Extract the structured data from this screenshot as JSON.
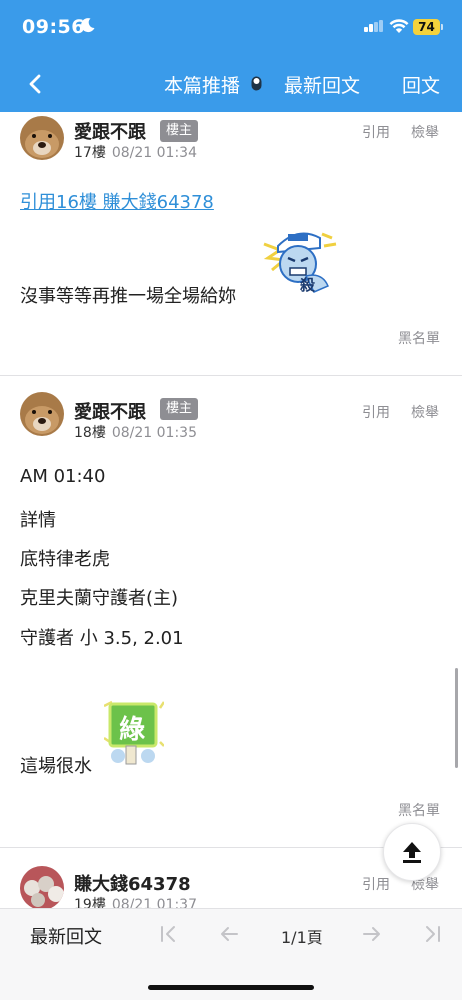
{
  "status_bar": {
    "time": "09:56",
    "battery": "74",
    "moon_icon": "moon-icon",
    "signal_icon": "cellular-signal-icon",
    "wifi_icon": "wifi-icon"
  },
  "nav": {
    "back_icon": "chevron-left-icon",
    "push_label": "本篇推播",
    "latest_label": "最新回文",
    "reply_label": "回文"
  },
  "posts": [
    {
      "username": "愛跟不跟",
      "badge": "樓主",
      "floor": "17樓",
      "timestamp": "08/21 01:34",
      "quote_label": "引用",
      "report_label": "檢舉",
      "quote_link": "引用16樓 賺大錢64378",
      "lines": [
        "沒事等等再推一場全場給妳"
      ],
      "sticker": "angry-kill-sticker",
      "blacklist_label": "黑名單"
    },
    {
      "username": "愛跟不跟",
      "badge": "樓主",
      "floor": "18樓",
      "timestamp": "08/21 01:35",
      "quote_label": "引用",
      "report_label": "檢舉",
      "lines": [
        "AM 01:40",
        "詳情",
        "底特律老虎",
        "克里夫蘭守護者(主)",
        "守護者 小 3.5, 2.01",
        "這場很水"
      ],
      "sticker": "green-sign-sticker",
      "sticker_text": "綠",
      "blacklist_label": "黑名單"
    },
    {
      "username": "賺大錢64378",
      "floor": "19樓",
      "timestamp": "08/21 01:37",
      "quote_label": "引用",
      "report_label": "檢舉"
    }
  ],
  "fab": {
    "icon": "scroll-to-top-icon"
  },
  "bottom_bar": {
    "latest_label": "最新回文",
    "page": "1/1頁",
    "first_icon": "first-page-icon",
    "prev_icon": "prev-page-icon",
    "next_icon": "next-page-icon",
    "last_icon": "last-page-icon"
  },
  "colors": {
    "header": "#3a9bea",
    "link": "#2f8fd8",
    "badge": "#8e8e93",
    "battery": "#f4d23c"
  }
}
